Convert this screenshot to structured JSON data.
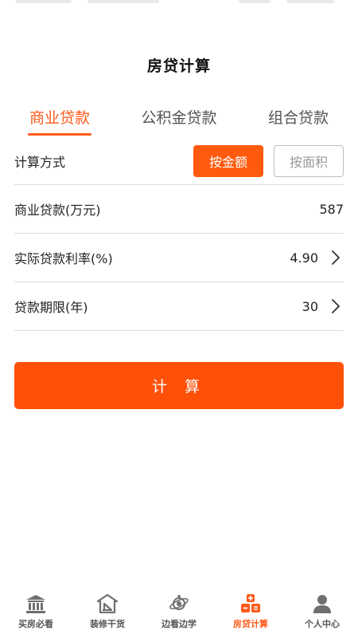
{
  "page": {
    "title": "房贷计算"
  },
  "tabs": [
    {
      "label": "商业贷款",
      "active": true
    },
    {
      "label": "公积金贷款",
      "active": false
    },
    {
      "label": "组合贷款",
      "active": false
    }
  ],
  "form": {
    "method": {
      "label": "计算方式",
      "by_amount": "按金额",
      "by_area": "按面积",
      "selected": "按金额"
    },
    "loan_amount": {
      "label": "商业贷款(万元)",
      "value": "587"
    },
    "rate": {
      "label": "实际贷款利率(%)",
      "value": "4.90"
    },
    "term": {
      "label": "贷款期限(年)",
      "value": "30"
    }
  },
  "calculate_button": "计 算",
  "colors": {
    "accent": "#ff5a1a",
    "button": "#ff500a",
    "icon_gray": "#6f6f6f"
  },
  "tabbar": [
    {
      "label": "买房必看",
      "icon": "bank-building-icon",
      "active": false
    },
    {
      "label": "装修干货",
      "icon": "house-tools-icon",
      "active": false
    },
    {
      "label": "边看边学",
      "icon": "planet-icon",
      "active": false
    },
    {
      "label": "房贷计算",
      "icon": "calculator-blocks-icon",
      "active": true
    },
    {
      "label": "个人中心",
      "icon": "person-icon",
      "active": false
    }
  ]
}
